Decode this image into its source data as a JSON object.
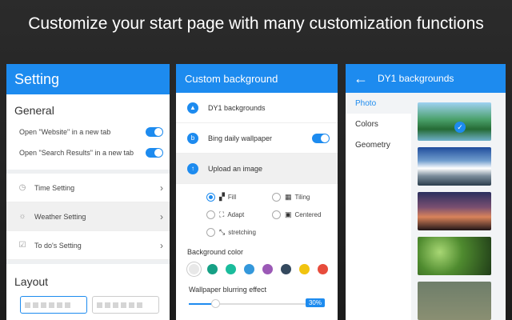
{
  "headline": "Customize your start page with many customization functions",
  "settings_panel": {
    "title": "Setting",
    "general_title": "General",
    "options": [
      {
        "label": "Open  \"Website\"   in a new tab",
        "enabled": true
      },
      {
        "label": "Open  \"Search Results\"  in a new tab",
        "enabled": true
      }
    ],
    "menu": [
      {
        "label": "Time Setting",
        "icon": "clock-icon"
      },
      {
        "label": "Weather Setting",
        "icon": "sun-icon"
      },
      {
        "label": "To do's Setting",
        "icon": "checklist-icon"
      }
    ],
    "layout_title": "Layout"
  },
  "custom_bg_panel": {
    "title": "Custom background",
    "rows": [
      {
        "label": "DY1 backgrounds",
        "icon": "image-icon"
      },
      {
        "label": "Bing daily wallpaper",
        "icon": "bing-icon",
        "toggle": true
      },
      {
        "label": "Upload an image",
        "icon": "upload-icon"
      }
    ],
    "fit_options": [
      {
        "label": "Fill",
        "checked": true
      },
      {
        "label": "Tiling",
        "checked": false
      },
      {
        "label": "Adapt",
        "checked": false
      },
      {
        "label": "Centered",
        "checked": false
      },
      {
        "label": "stretching",
        "checked": false
      }
    ],
    "bg_color_label": "Background color",
    "colors": [
      "#e8e8e8",
      "#16a085",
      "#1abc9c",
      "#3498db",
      "#9b59b6",
      "#34495e",
      "#f1c40f",
      "#e74c3c"
    ],
    "blur_label": "Wallpaper blurring effect",
    "blur_value": "30%",
    "blur_fraction": 0.2
  },
  "backgrounds_panel": {
    "title": "DY1 backgrounds",
    "categories": [
      "Photo",
      "Colors",
      "Geometry"
    ],
    "active_category": "Photo"
  }
}
